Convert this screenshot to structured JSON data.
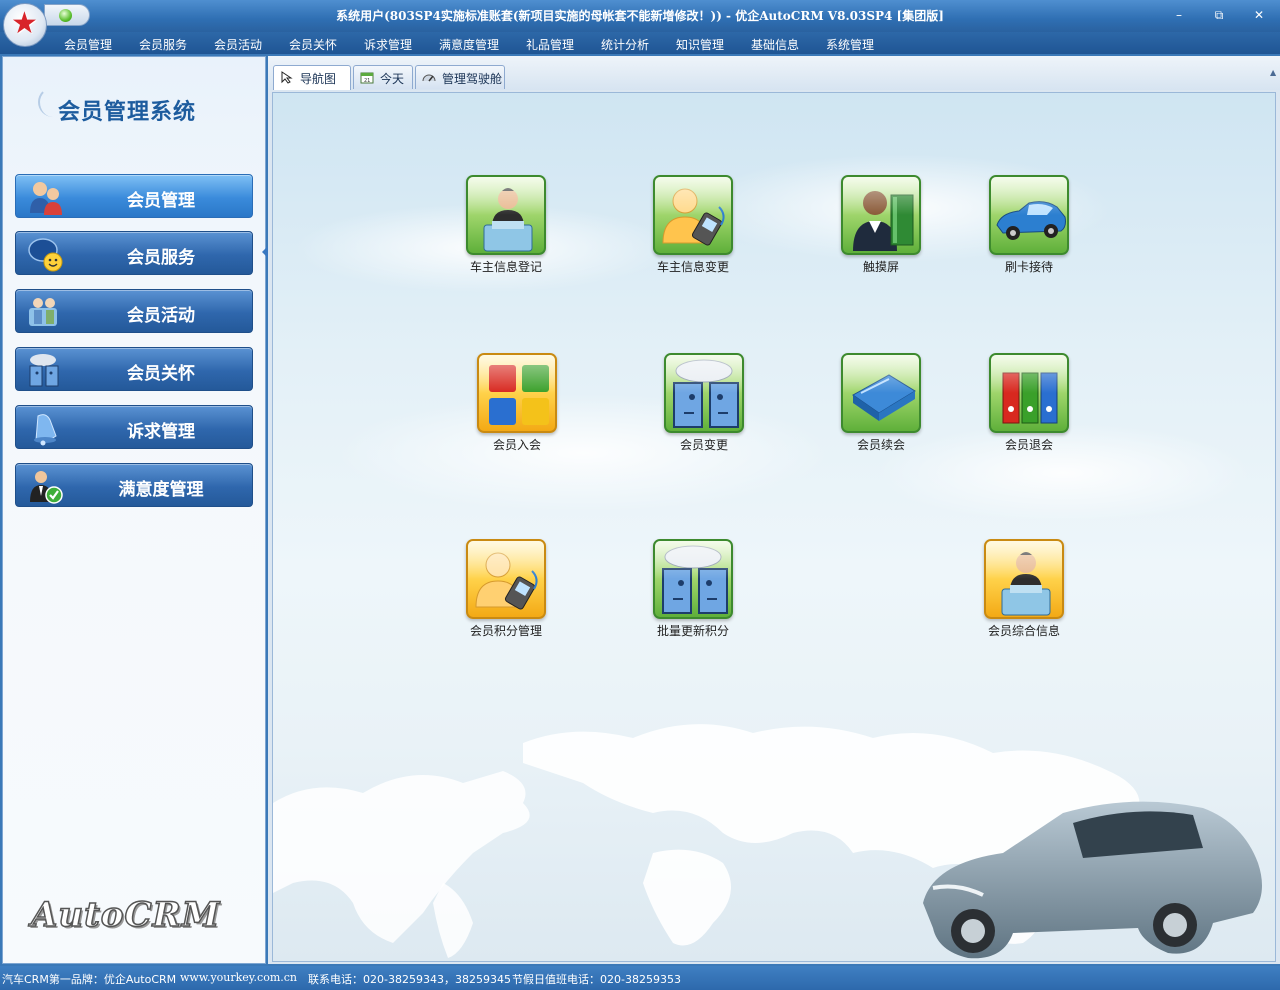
{
  "window": {
    "title": "系统用户(803SP4实施标准账套(新项目实施的母帐套不能新增修改！)) - 优企AutoCRM V8.03SP4 [集团版]",
    "controls": {
      "minimize": "–",
      "restore": "⧉",
      "close": "✕"
    }
  },
  "menu": [
    "会员管理",
    "会员服务",
    "会员活动",
    "会员关怀",
    "诉求管理",
    "满意度管理",
    "礼品管理",
    "统计分析",
    "知识管理",
    "基础信息",
    "系统管理"
  ],
  "sidebar": {
    "title": "会员管理系统",
    "items": [
      {
        "label": "会员管理",
        "icon": "members-icon",
        "active": true
      },
      {
        "label": "会员服务",
        "icon": "service-chat-icon",
        "active": false
      },
      {
        "label": "会员活动",
        "icon": "activity-icon",
        "active": false
      },
      {
        "label": "会员关怀",
        "icon": "care-faces-icon",
        "active": false
      },
      {
        "label": "诉求管理",
        "icon": "bell-icon",
        "active": false
      },
      {
        "label": "满意度管理",
        "icon": "satisfaction-check-icon",
        "active": false
      }
    ],
    "brand": "AutoCRM"
  },
  "tabs": [
    {
      "label": "导航图",
      "icon": "pointer-icon",
      "active": true
    },
    {
      "label": "今天",
      "icon": "calendar-icon",
      "active": false
    },
    {
      "label": "管理驾驶舱",
      "icon": "gauge-icon",
      "active": false
    }
  ],
  "nav_icons": [
    {
      "label": "车主信息登记",
      "icon": "desk-agent-icon",
      "color": "green"
    },
    {
      "label": "车主信息变更",
      "icon": "person-phone-icon",
      "color": "green"
    },
    {
      "label": "触摸屏",
      "icon": "person-book-icon",
      "color": "green"
    },
    {
      "label": "刷卡接待",
      "icon": "car-icon",
      "color": "green"
    },
    {
      "label": "会员入会",
      "icon": "windows-tiles-icon",
      "color": "orange"
    },
    {
      "label": "会员变更",
      "icon": "talking-faces-icon",
      "color": "green"
    },
    {
      "label": "会员续会",
      "icon": "blue-folder-icon",
      "color": "green"
    },
    {
      "label": "会员退会",
      "icon": "binders-icon",
      "color": "green"
    },
    {
      "label": "会员积分管理",
      "icon": "person-phone-icon",
      "color": "orange"
    },
    {
      "label": "批量更新积分",
      "icon": "talking-faces-icon",
      "color": "green"
    },
    {
      "label": "会员综合信息",
      "icon": "desk-agent-icon",
      "color": "orange"
    }
  ],
  "status": {
    "brand": "汽车CRM第一品牌：优企AutoCRM",
    "site": "www.yourkey.com.cn",
    "phone": "联系电话：020-38259343，38259345",
    "holiday": "节假日值班电话：020-38259353"
  }
}
